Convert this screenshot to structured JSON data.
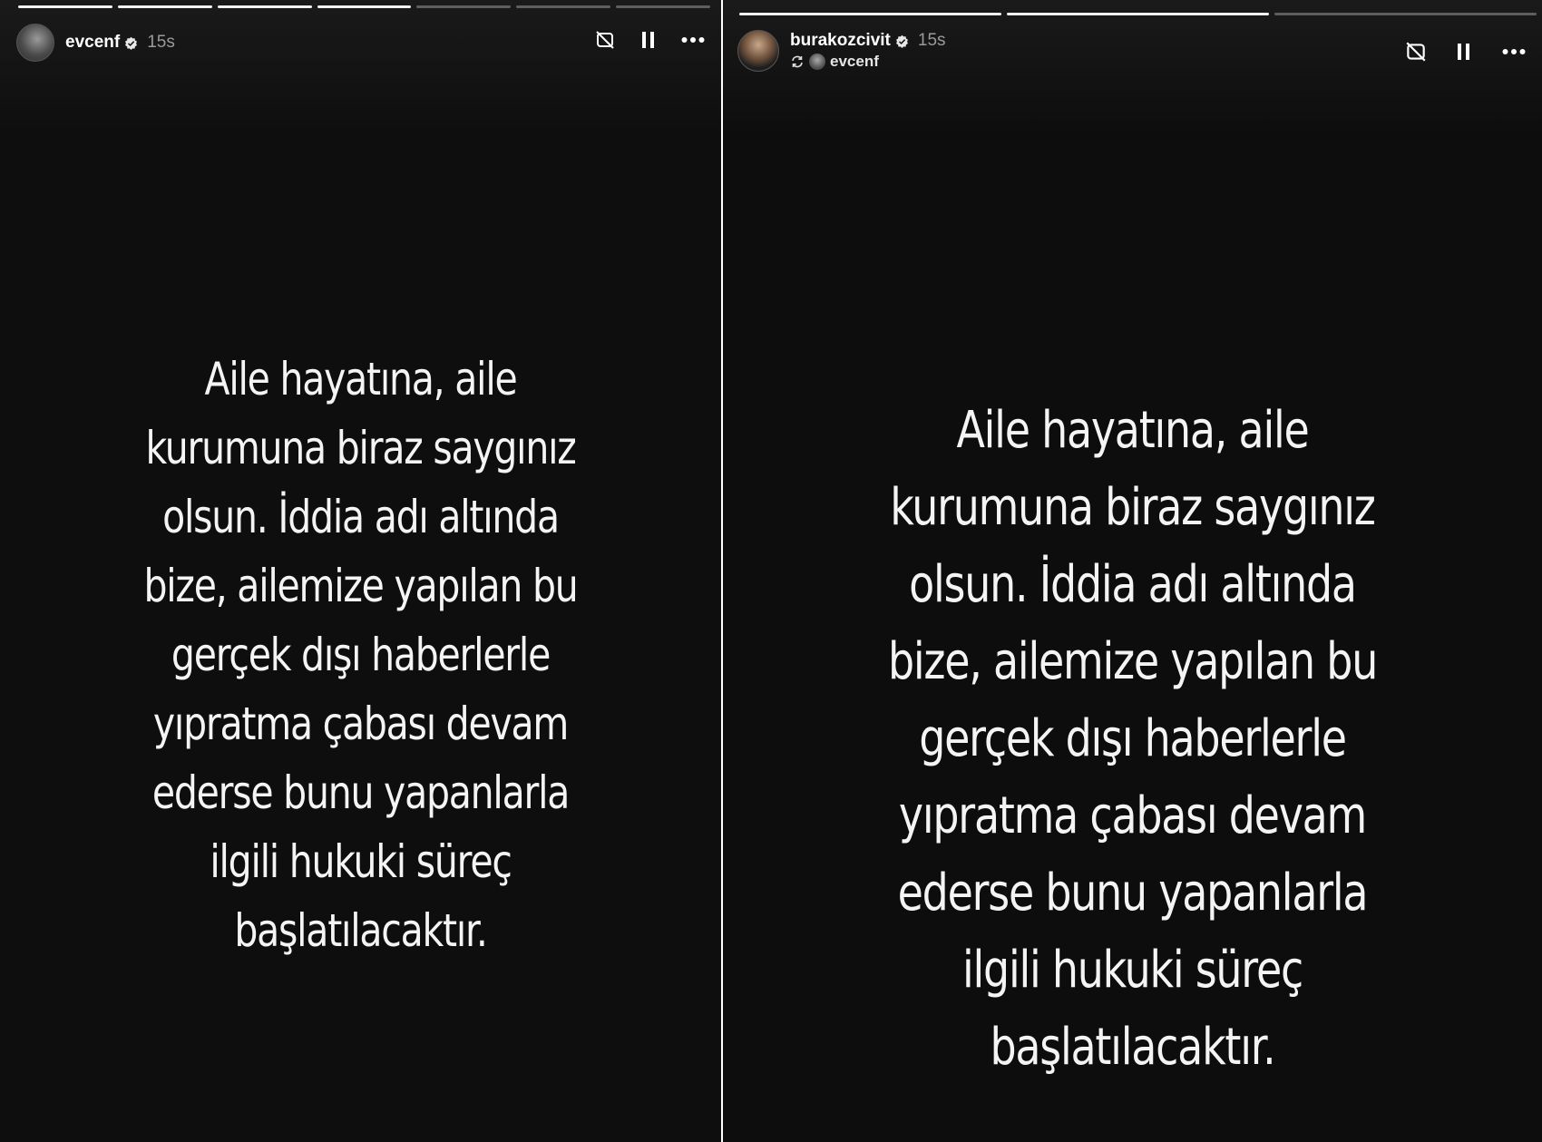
{
  "stories": [
    {
      "username": "evcenf",
      "verified": true,
      "time": "15s",
      "progress_segments": [
        1,
        1,
        1,
        1,
        0,
        0,
        0
      ],
      "controls": [
        "mute-icon",
        "pause-icon",
        "more-icon"
      ],
      "message_lines": [
        "Aile hayatına, aile",
        "kurumuna biraz saygınız",
        "olsun. İddia adı altında",
        "bize, ailemize yapılan bu",
        "gerçek dışı haberlerle",
        "yıpratma çabası devam",
        "ederse bunu yapanlarla",
        "ilgili hukuki süreç",
        "başlatılacaktır."
      ]
    },
    {
      "username": "burakozcivit",
      "verified": true,
      "time": "15s",
      "reposted_from": "evcenf",
      "progress_segments": [
        1,
        1,
        0
      ],
      "controls": [
        "mute-icon",
        "pause-icon",
        "more-icon"
      ],
      "message_lines": [
        "Aile hayatına, aile",
        "kurumuna biraz saygınız",
        "olsun. İddia adı altında",
        "bize, ailemize yapılan bu",
        "gerçek dışı haberlerle",
        "yıpratma çabası devam",
        "ederse bunu yapanlarla",
        "ilgili hukuki süreç",
        "başlatılacaktır."
      ]
    }
  ],
  "colors": {
    "background": "#0d0d0d",
    "text": "#f4f4f4",
    "muted": "#9a9a9a"
  }
}
